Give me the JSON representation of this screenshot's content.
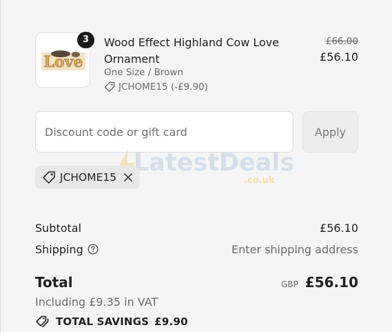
{
  "product": {
    "quantity": "3",
    "title": "Wood Effect Highland Cow Love Ornament",
    "variant": "One Size / Brown",
    "discount_applied": "JCHOME15 (-£9.90)",
    "price_original": "£66.00",
    "price_current": "£56.10",
    "image_alt": "Wooden Love ornament",
    "image_word": "Love"
  },
  "discount": {
    "placeholder": "Discount code or gift card",
    "apply_label": "Apply",
    "applied_code": "JCHOME15"
  },
  "watermark": {
    "brand": "LatestDeals",
    "domain": ".co.uk"
  },
  "summary": {
    "subtotal_label": "Subtotal",
    "subtotal_value": "£56.10",
    "shipping_label": "Shipping",
    "shipping_value": "Enter shipping address",
    "total_label": "Total",
    "currency": "GBP",
    "total_value": "£56.10",
    "vat_note": "Including £9.35 in VAT",
    "savings_label": "TOTAL SAVINGS",
    "savings_value": "£9.90"
  },
  "colors": {
    "background": "#f5f5f5",
    "text": "#1f1f1f",
    "muted": "#6b6b6b",
    "badge": "#1a1a1a"
  },
  "icons": {
    "tag": "tag-icon",
    "remove": "close-icon",
    "help": "question-circle-icon",
    "savings": "tags-icon"
  }
}
